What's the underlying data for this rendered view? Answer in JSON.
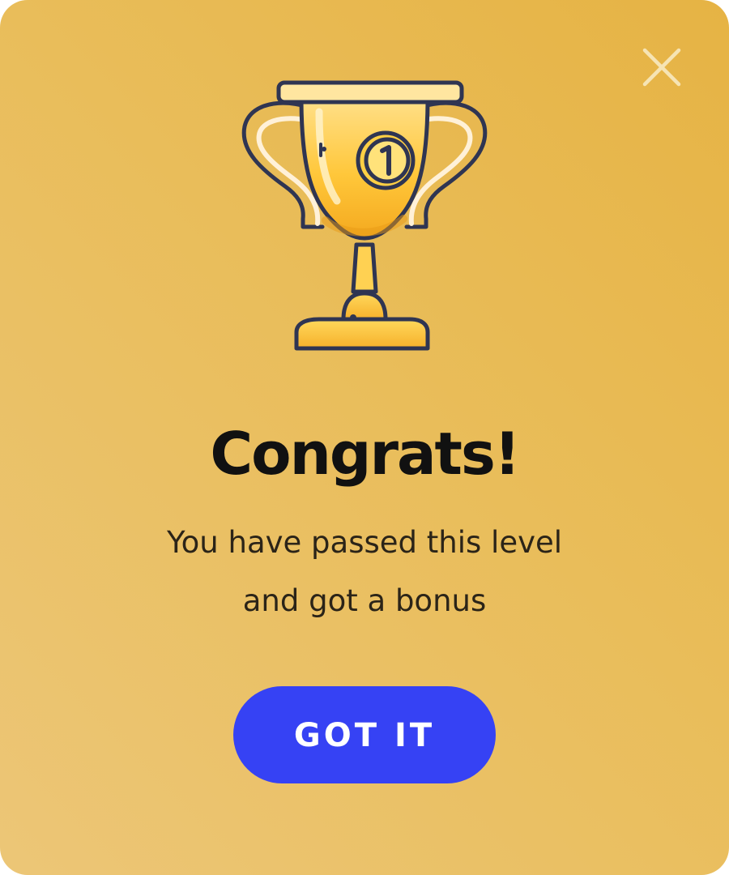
{
  "dialog": {
    "title": "Congrats!",
    "message_line1": "You have passed this level",
    "message_line2": "and got a bonus",
    "button_label": "GOT IT",
    "close_icon": "close-icon",
    "trophy_icon": "trophy-icon",
    "trophy_number": "1"
  },
  "colors": {
    "background_start": "#e6b344",
    "background_end": "#ecc677",
    "button": "#3642f4",
    "button_text": "#ffffff",
    "title": "#111111",
    "close_icon": "#f6e4b4"
  }
}
